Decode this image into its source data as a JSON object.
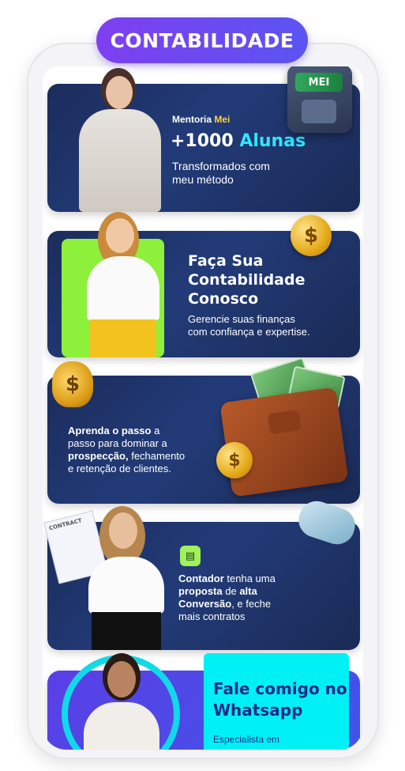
{
  "header": {
    "title": "CONTABILIDADE"
  },
  "cards": [
    {
      "label_prefix": "Mentoria ",
      "label_highlight": "Mei",
      "headline_prefix": "+1000 ",
      "headline_highlight": "Alunas",
      "subtitle_line1": "Transformados com",
      "subtitle_line2": "meu método",
      "badge_text": "MEI"
    },
    {
      "heading_line1": "Faça Sua",
      "heading_line2": "Contabilidade",
      "heading_line3": "Conosco",
      "body_line1": "Gerencie suas finanças",
      "body_line2": "com confiança e expertise.",
      "coin_symbol": "$"
    },
    {
      "bold1": "Aprenda o passo",
      "text1": " a",
      "line2": "passo para dominar a",
      "bold2": "prospecção,",
      "text2": " fechamento",
      "line4": "e retenção de clientes.",
      "bag_symbol": "$"
    },
    {
      "bold1": "Contador",
      "text1": " tenha uma",
      "bold2": "proposta",
      "text2": " de ",
      "bold3": "alta",
      "bold4": "Conversão",
      "text3": ", e feche",
      "line4": "mais contratos",
      "contract_label": "CONTRACT"
    },
    {
      "title_line1": "Fale comigo no",
      "title_line2": "Whatsapp",
      "subtitle": "Especialista em"
    }
  ],
  "colors": {
    "pill": "#6a48f0",
    "card": "#1f3268",
    "cyan": "#00f1f5",
    "yellow": "#ffd23a"
  }
}
